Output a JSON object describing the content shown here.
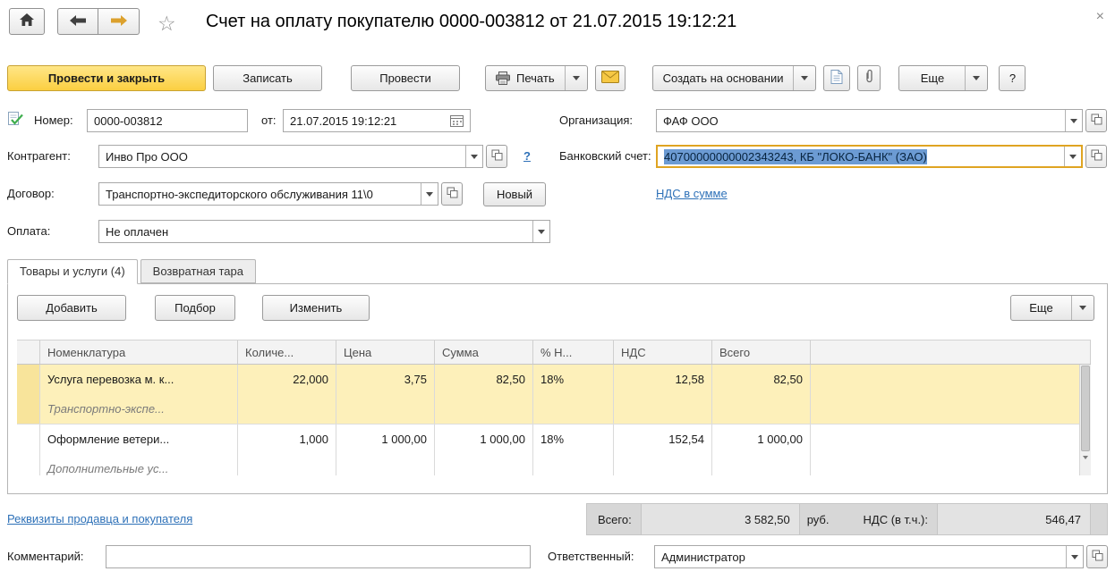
{
  "titlebar": {
    "title": "Счет на оплату покупателю 0000-003812 от 21.07.2015 19:12:21",
    "close": "×"
  },
  "toolbar": {
    "post_and_close": "Провести и закрыть",
    "save": "Записать",
    "post": "Провести",
    "print": "Печать",
    "create_on_base": "Создать на основании",
    "more": "Еще",
    "help": "?"
  },
  "form": {
    "number": {
      "label": "Номер:",
      "value": "0000-003812"
    },
    "date": {
      "label": "от:",
      "value": "21.07.2015 19:12:21"
    },
    "organization": {
      "label": "Организация:",
      "value": "ФАФ ООО"
    },
    "contractor": {
      "label": "Контрагент:",
      "value": "Инво Про ООО",
      "help": "?"
    },
    "bank_account": {
      "label": "Банковский счет:",
      "value": "40700000000002343243, КБ \"ЛОКО-БАНК\" (ЗАО)"
    },
    "contract": {
      "label": "Договор:",
      "value": "Транспортно-экспедиторского обслуживания 11\\0",
      "new_button": "Новый"
    },
    "vat_link": "НДС в сумме",
    "payment": {
      "label": "Оплата:",
      "value": "Не оплачен"
    }
  },
  "tabs": {
    "goods": "Товары и услуги (4)",
    "returnable": "Возвратная тара"
  },
  "items_toolbar": {
    "add": "Добавить",
    "pick": "Подбор",
    "edit": "Изменить",
    "more": "Еще"
  },
  "items_table": {
    "headers": {
      "nomenclature": "Номенклатура",
      "quantity": "Количе...",
      "price": "Цена",
      "sum": "Сумма",
      "vat_rate": "% Н...",
      "vat": "НДС",
      "total": "Всего"
    },
    "rows": [
      {
        "nomenclature": "Услуга перевозка м. к...",
        "detail": "Транспортно-экспе...",
        "quantity": "22,000",
        "price": "3,75",
        "sum": "82,50",
        "vat_rate": "18%",
        "vat": "12,58",
        "total": "82,50"
      },
      {
        "nomenclature": "Оформление ветери...",
        "detail": "Дополнительные ус...",
        "quantity": "1,000",
        "price": "1 000,00",
        "sum": "1 000,00",
        "vat_rate": "18%",
        "vat": "152,54",
        "total": "1 000,00"
      }
    ]
  },
  "footer": {
    "details_link": "Реквизиты продавца и покупателя",
    "total_label": "Всего:",
    "total_value": "3 582,50",
    "currency": "руб.",
    "vat_label": "НДС (в т.ч.):",
    "vat_value": "546,47"
  },
  "bottom": {
    "comment_label": "Комментарий:",
    "comment_value": "",
    "responsible_label": "Ответственный:",
    "responsible_value": "Администратор"
  }
}
